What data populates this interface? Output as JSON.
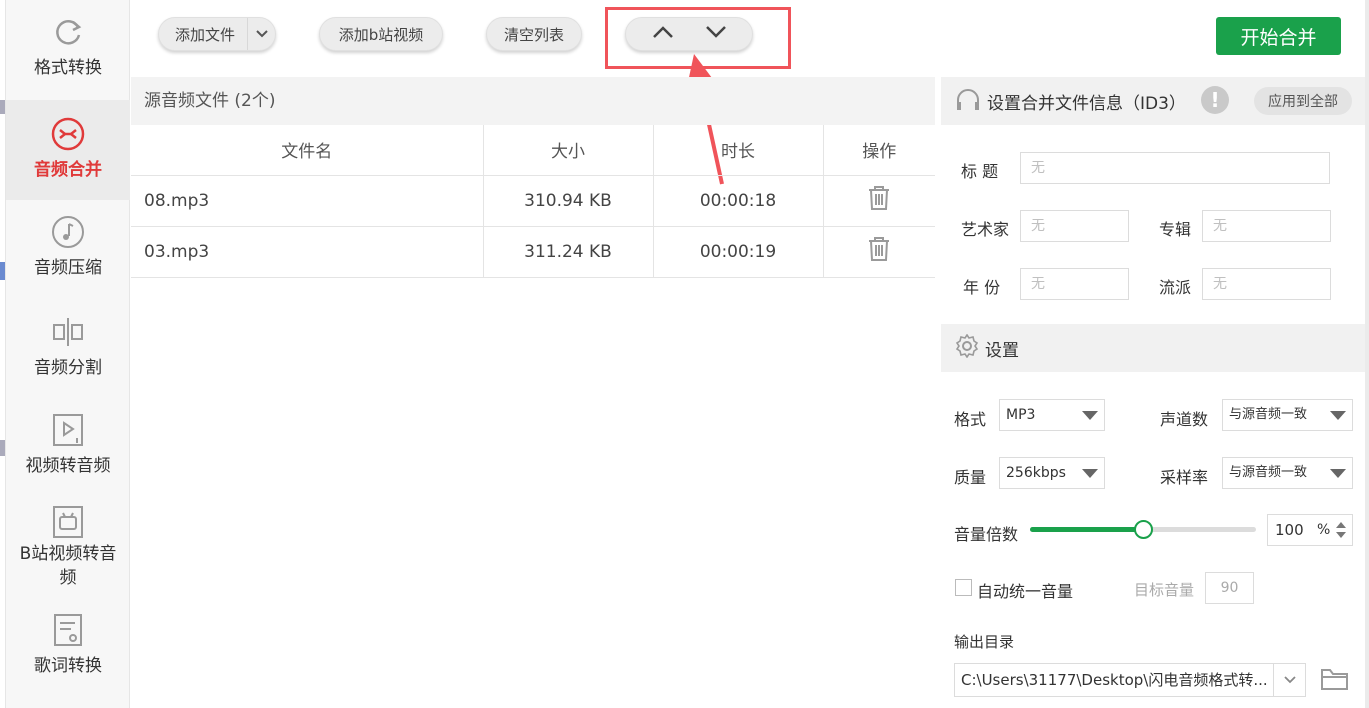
{
  "sidebar": {
    "items": [
      {
        "label": "格式转换",
        "icon": "refresh-icon"
      },
      {
        "label": "音频合并",
        "icon": "merge-icon",
        "active": true
      },
      {
        "label": "音频压缩",
        "icon": "music-note-icon"
      },
      {
        "label": "音频分割",
        "icon": "split-icon"
      },
      {
        "label": "视频转音频",
        "icon": "video-icon"
      },
      {
        "label": "B站视频转音频",
        "icon": "bilibili-icon"
      },
      {
        "label": "歌词转换",
        "icon": "lyrics-icon"
      }
    ]
  },
  "toolbar": {
    "add_file": "添加文件",
    "add_bilibili": "添加b站视频",
    "clear_list": "清空列表",
    "start_merge": "开始合并"
  },
  "file_list": {
    "header": "源音频文件 (2个)",
    "columns": [
      "文件名",
      "大小",
      "时长",
      "操作"
    ],
    "rows": [
      {
        "name": "08.mp3",
        "size": "310.94 KB",
        "duration": "00:00:18"
      },
      {
        "name": "03.mp3",
        "size": "311.24 KB",
        "duration": "00:00:19"
      }
    ]
  },
  "id3": {
    "title": "设置合并文件信息（ID3）",
    "apply_all": "应用到全部",
    "fields": {
      "title_label": "标  题",
      "artist_label": "艺术家",
      "album_label": "专辑",
      "year_label": "年  份",
      "genre_label": "流派",
      "placeholder": "无"
    }
  },
  "settings": {
    "title": "设置",
    "format_label": "格式",
    "format_value": "MP3",
    "channels_label": "声道数",
    "channels_value": "与源音频一致",
    "quality_label": "质量",
    "quality_value": "256kbps",
    "samplerate_label": "采样率",
    "samplerate_value": "与源音频一致",
    "volume_label": "音量倍数",
    "volume_value": "100",
    "volume_unit": "%",
    "volume_fraction": 0.5,
    "auto_volume_label": "自动统一音量",
    "target_volume_label": "目标音量",
    "target_volume_value": "90",
    "output_label": "输出目录",
    "output_path": "C:\\Users\\31177\\Desktop\\闪电音频格式转..."
  },
  "colors": {
    "accent_green": "#1aa14b",
    "active_red": "#e03a3a",
    "highlight_red": "#f0545a"
  }
}
